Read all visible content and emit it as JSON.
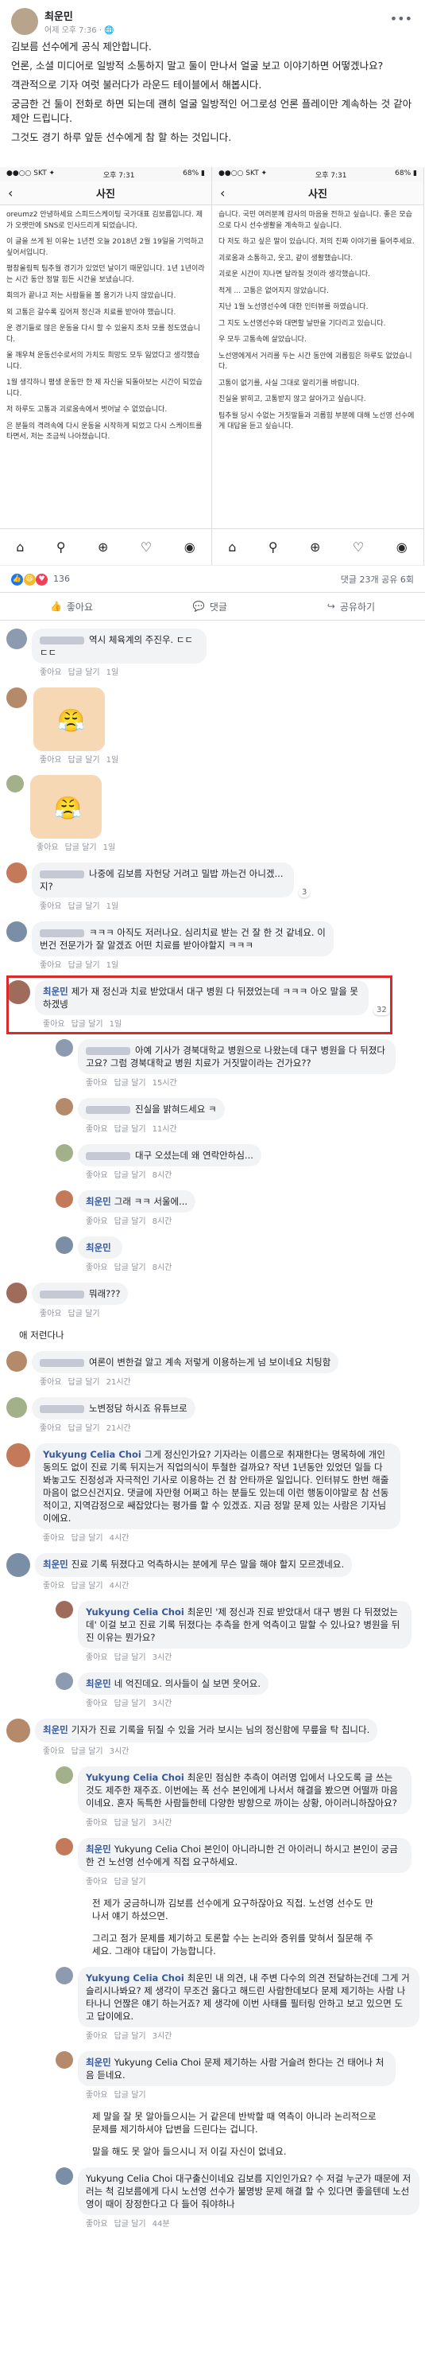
{
  "post": {
    "author": "최운민",
    "time": "어제 오후 7:36 · ",
    "paragraphs": [
      "김보름 선수에게 공식 제안합니다.",
      "언론, 소셜 미디어로 일방적 소통하지 말고 둘이 만나서 얼굴 보고 이야기하면 어떻겠나요?",
      "객관적으로 기자 여럿 불러다가 라운드 테이블에서 해봅시다.",
      "궁금한 건 둘이 전화로 하면 되는데 괜히 얼굴 일방적인 어그로성 언론 플레이만 계속하는 것 같아 제안 드립니다.",
      "그것도 경기 하루 앞둔 선수에게 참 할 하는 것입니다."
    ]
  },
  "shots": [
    {
      "status_left": "●●○○ SKT ✦",
      "status_time": "오후 7:31",
      "status_right": "68% ▮",
      "title": "사진",
      "lines": [
        "oreumz2 안녕하세요 스피드스케이팅 국가대표 김보름입니다. 제가 오랫만에 SNS로 인사드리게 되었습니다.",
        "이 글을 쓰게 된 이유는 1년전 오늘 2018년 2월 19일을 기억하고 싶어서입니다.",
        "평창올림픽 팀추월 경기가 있었던 날이기 때문입니다. 1년 1년이라는 시간 동안 정말 힘든 시간을 보냈습니다.",
        "회의가 끝나고 저는 사람들을 볼 용기가 나지 않았습니다.",
        "외 고통은 갈수록 깊어져 정신과 치료를 받아야 했습니다.",
        "운 경기들로 많은 운동을 다시 할 수 있을지 조차 모를 정도였습니다.",
        "울 깨우쳐 운동선수로서의 가치도 희망도 모두 잃었다고 생각했습니다.",
        "1월 생각하니 평생 운동만 한 제 자신을 되돌아보는 시간이 되었습니다.",
        "저 하루도 고통과 괴로움속에서 벗어날 수 없었습니다.",
        "은 분들의 격려속에 다시 운동을 시작하게 되었고 다시 스케이트를 타면서, 저는 조금씩 나아졌습니다."
      ]
    },
    {
      "status_left": "●●○○ SKT ✦",
      "status_time": "오후 7:31",
      "status_right": "68% ▮",
      "title": "사진",
      "lines": [
        "습니다. 국민 여러분께 감사의 마음을 전하고 싶습니다. 좋은 모습으로 다시 선수생활을 계속하고 싶습니다.",
        "다 저도 하고 싶은 말이 있습니다. 저의 진짜 이야기를 들어주세요.",
        "괴로움과 소통하고, 웃고, 같이 생활했습니다.",
        "괴로운 시간이 지나면 달라질 것이라 생각했습니다.",
        "적게 ... 고통은 없어지지 않았습니다.",
        "지난 1월 노선영선수에 대한 인터뷰를 하였습니다.",
        "그 지도 노선영선수와 대면할 날만을 기다리고 있습니다.",
        "우 모두 고통속에 살았습니다.",
        "노선영에게서 거리를 두는 시간 동안에 괴롭힘은 하루도 없었습니다.",
        "고통이 없기를, 사실 그대로 알리기를 바랍니다.",
        "진실을 밝히고, 고통받지 않고 살아가고 싶습니다.",
        "팀추월 당시 수없는 거짓말들과 괴롭힘 부분에 대해 노선영 선수에게 대답을 듣고 싶습니다."
      ]
    }
  ],
  "reactions": {
    "count": "136",
    "comments": "댓글 23개",
    "shares": "공유 6회"
  },
  "actions": {
    "like": "좋아요",
    "comment": "댓글",
    "share": "공유하기"
  },
  "meta": {
    "like": "좋아요",
    "reply": "답글 달기"
  },
  "comments": [
    {
      "name": "",
      "text": "역시 체육계의 주진우. ㄷㄷㄷㄷ",
      "time": "1일"
    },
    {
      "name": "",
      "text": "",
      "time": "1일",
      "sticker": true
    },
    {
      "name": "",
      "text": "",
      "time": "1일",
      "sticker": true
    },
    {
      "name": "",
      "text": "나중에 김보름 자헌당 거려고 밀밥 까는건 아니겠...지?",
      "time": "1일",
      "count": "3"
    },
    {
      "name": "",
      "text": "ㅋㅋㅋ 아직도 저러나요. 심리치료 받는 건 잘 한 것 같네요. 이번건 전문가가 잘 알겠죠 어떤 치료를 받아야할지 ㅋㅋㅋ",
      "time": "1일"
    },
    {
      "name": "최운민",
      "text": "제가 재 정신과 치료 받았대서 대구 병원 다 뒤졌었는데 ㅋㅋㅋ 아오 말을 못하겠넹",
      "time": "1일",
      "count": "32"
    },
    {
      "name": "",
      "text": "아예 기사가 경북대학교 병원으로 나왔는데 대구 병원을 다 뒤졌다고요? 그럼 경북대학교 병원 치료가 거짓말이라는 건가요??",
      "time": "15시간"
    },
    {
      "name": "",
      "text": "진실을 밝혀드세요 ㅋ",
      "time": "11시간"
    },
    {
      "name": "",
      "text": "대구 오셨는데 왜 연락안하심...",
      "time": "8시간"
    },
    {
      "name": "최운민",
      "text": "그래 ㅋㅋ 서울에...",
      "time": "8시간"
    },
    {
      "name": "최운민",
      "text": "",
      "time": "8시간"
    },
    {
      "name": "",
      "text": "뭐래???",
      "time": ""
    },
    {
      "name": "",
      "text": "애 저런다나",
      "time": ""
    },
    {
      "name": "",
      "text": "여론이 변한걸 알고 계속 저렇게 이용하는게 넘 보이네요 치팅함",
      "time": "21시간"
    },
    {
      "name": "",
      "text": "노변정담 하시죠 유튜브로",
      "time": "21시간"
    },
    {
      "name": "Yukyung Celia Choi",
      "text": "그게 정신인가요? 기자라는 이름으로 취재한다는 명목하에 개인동의도 없이 진료 기록 뒤지는거 직업의식이 투철한 걸까요? 작년 1년동안 있었던 일들 다 봐놓고도 진정성과 자극적인 기사로 이용하는 건 참 안타까운 일입니다. 인터뷰도 한번 해줄 마음이 없으신건지요. 댓글에 자만형 어쩌고 하는 분들도 있는데 이런 행동이야말로 참 선동적이고, 지역감정으로 쌔잡았다는 평가를 할 수 있겠죠. 지금 정말 문제 있는 사람은 기자님이에요.",
      "time": "4시간"
    },
    {
      "name": "최운민",
      "text": "진료 기록 뒤졌다고 억측하시는 분에게 무슨 말을 해야 할지 모르겠네요.",
      "time": "4시간"
    },
    {
      "name": "Yukyung Celia Choi",
      "text": "최운민 '제 정신과 진료 받았대서 대구 병원 다 뒤졌었는데' 이걸 보고 진료 기록 뒤졌다는 추측을 한게 억측이고 말할 수 있나요? 병원을 뒤진 이유는 뭔가요?",
      "time": "3시간"
    },
    {
      "name": "최운민",
      "text": "네 억진데요. 의사들이 실 보면 웃어요.",
      "time": "3시간"
    },
    {
      "name": "최운민",
      "text": "기자가 진료 기록을 뒤질 수 있을 거라 보시는 님의 정신함에 무릎을 탁 칩니다.",
      "time": "3시간"
    },
    {
      "name": "Yukyung Celia Choi",
      "text": "최운민 점심한 추측이 여러명 입에서 나오도록 글 쓰는 것도 제주한 재주죠. 이번에는 폭 선수 본인에게 나서서 해결을 봤으면 어떨까 마음이네요. 혼자 독특한 사람들한테 다양한 방향으로 까이는 상황, 아이러니하잖아요?",
      "time": "3시간"
    },
    {
      "name": "최운민",
      "text": "Yukyung Celia Choi 본인이 아니라니한 건 아이러니 하시고 본인이 궁금한 건 노선영 선수에게 직접 요구하세요.",
      "time": ""
    },
    {
      "name": "",
      "text": "전 제가 궁금하니까 김보름 선수에게 요구하잖아요 직접. 노선영 선수도 만나서 얘기 하셨으면.",
      "time": ""
    },
    {
      "name": "",
      "text": "그리고 점가 문제를 제기하고 토론할 수는 논리와 증위를 맞혀서 질문해 주세요. 그래야 대답이 가능합니다.",
      "time": "3시간"
    },
    {
      "name": "Yukyung Celia Choi",
      "text": "최운민 내 의견, 내 주변 다수의 의견 전달하는건데 그게 거슬리시나봐요? 제 생각이 무조건 옳다고 해드린 사람한데보다 문제 제기하는 사람 나타나니 언짢은 얘기 하는거죠? 제 생각에 이번 사태를 필터링 안하고 보고 있으면 도 고 답이에요.",
      "time": "3시간"
    },
    {
      "name": "최운민",
      "text": "Yukyung Celia Choi 문제 제기하는 사람 거슬려 한다는 건 태어나 처음 듣네요.",
      "time": ""
    },
    {
      "name": "",
      "text": "제 말을 잘 못 알아들으시는 거 같은데 반박할 때 역측이 아니라 논리적으로 문제를 제기하셔야 답변을 드린다는 겁니다.",
      "time": ""
    },
    {
      "name": "",
      "text": "말을 해도 못 알아 들으시니 저 이길 자신이 없네요.",
      "time": "3시간"
    },
    {
      "name": "",
      "text": "Yukyung Celia Choi 대구출신이네요 김보름 지인인가요? 수 저걸 누군가 때문에 저러는 척 김보름에게 다시 노선영 선수가 불명방 문제 해결 할 수 있다면 좋을텐데 노선영이 때이 장정한다고 다 들어 줘야하나",
      "time": "44분"
    }
  ]
}
